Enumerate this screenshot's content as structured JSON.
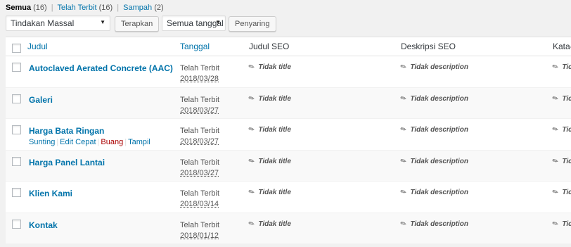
{
  "filters": {
    "all": {
      "label": "Semua",
      "count": "(16)"
    },
    "published": {
      "label": "Telah Terbit",
      "count": "(16)"
    },
    "trash": {
      "label": "Sampah",
      "count": "(2)"
    }
  },
  "toolbar": {
    "bulk_action": "Tindakan Massal",
    "apply": "Terapkan",
    "date_filter": "Semua tanggal",
    "filter": "Penyaring"
  },
  "columns": {
    "title": "Judul",
    "date": "Tanggal",
    "seo_title": "Judul SEO",
    "seo_desc": "Deskripsi SEO",
    "keywords": "Kata-k"
  },
  "rows": [
    {
      "title": "Autoclaved Aerated Concrete (AAC)",
      "status": "Telah Terbit",
      "date": "2018/03/28",
      "seo_title": "Tidak title",
      "seo_desc": "Tidak description",
      "kw": "Tic"
    },
    {
      "title": "Galeri",
      "status": "Telah Terbit",
      "date": "2018/03/27",
      "seo_title": "Tidak title",
      "seo_desc": "Tidak description",
      "kw": "Tic"
    },
    {
      "title": "Harga Bata Ringan",
      "status": "Telah Terbit",
      "date": "2018/03/27",
      "seo_title": "Tidak title",
      "seo_desc": "Tidak description",
      "kw": "Tic",
      "actions": {
        "edit": "Sunting",
        "quick_edit": "Edit Cepat",
        "trash": "Buang",
        "view": "Tampil"
      }
    },
    {
      "title": "Harga Panel Lantai",
      "status": "Telah Terbit",
      "date": "2018/03/27",
      "seo_title": "Tidak title",
      "seo_desc": "Tidak description",
      "kw": "Tic"
    },
    {
      "title": "Klien Kami",
      "status": "Telah Terbit",
      "date": "2018/03/14",
      "seo_title": "Tidak title",
      "seo_desc": "Tidak description",
      "kw": "Tic"
    },
    {
      "title": "Kontak",
      "status": "Telah Terbit",
      "date": "2018/01/12",
      "seo_title": "Tidak title",
      "seo_desc": "Tidak description",
      "kw": "Tic"
    }
  ],
  "icons": {
    "seo": "pencil-icon",
    "dropdown": "triangle-down-icon"
  },
  "colors": {
    "link": "#0073aa",
    "trash": "#a00",
    "background": "#f1f1f1"
  }
}
